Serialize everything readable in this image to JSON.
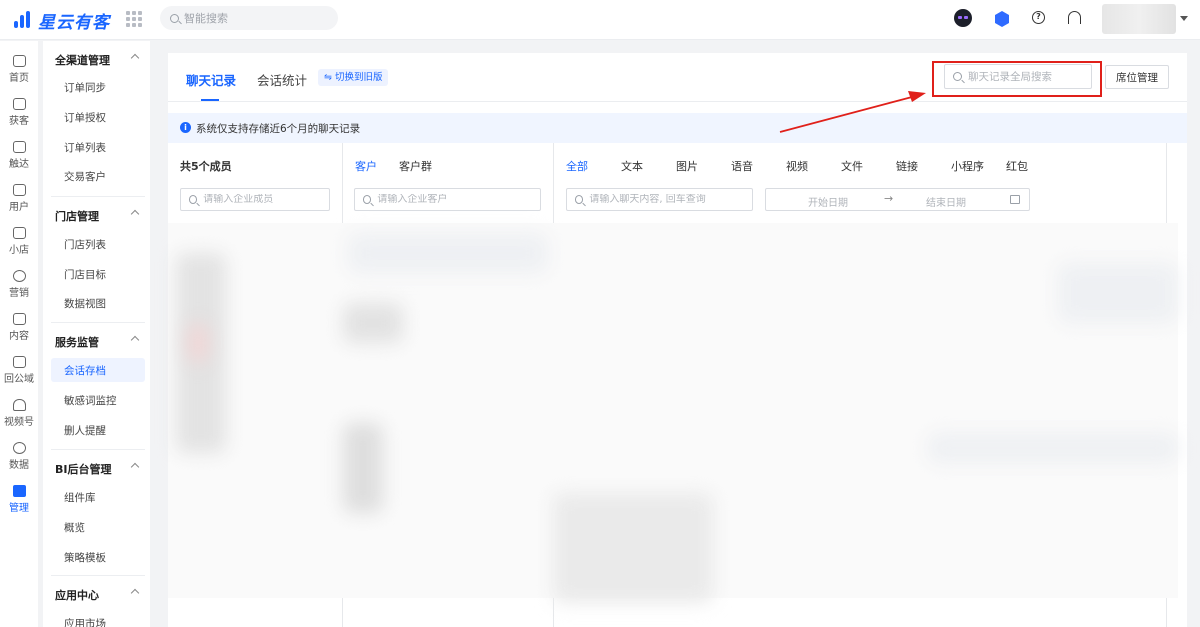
{
  "header": {
    "logo_text": "星云有客",
    "search_placeholder": "智能搜索",
    "icons": [
      "robot-assistant-icon",
      "cube-icon",
      "help-icon",
      "headset-icon"
    ]
  },
  "rail": {
    "items": [
      {
        "label": "首页",
        "icon": "home-icon"
      },
      {
        "label": "获客",
        "icon": "acquire-icon"
      },
      {
        "label": "触达",
        "icon": "send-icon"
      },
      {
        "label": "用户",
        "icon": "user-icon"
      },
      {
        "label": "小店",
        "icon": "store-icon"
      },
      {
        "label": "营销",
        "icon": "bulb-icon"
      },
      {
        "label": "内容",
        "icon": "folder-icon"
      },
      {
        "label": "回公域",
        "icon": "public-icon"
      },
      {
        "label": "视频号",
        "icon": "video-icon"
      },
      {
        "label": "数据",
        "icon": "pie-icon"
      },
      {
        "label": "管理",
        "icon": "manage-icon"
      }
    ],
    "active_index": 10
  },
  "submenu": {
    "groups": [
      {
        "title": "全渠道管理",
        "items": [
          "订单同步",
          "订单授权",
          "订单列表",
          "交易客户"
        ]
      },
      {
        "title": "门店管理",
        "items": [
          "门店列表",
          "门店目标",
          "数据视图"
        ]
      },
      {
        "title": "服务监管",
        "items": [
          "会话存档",
          "敏感词监控",
          "删人提醒"
        ]
      },
      {
        "title": "BI后台管理",
        "items": [
          "组件库",
          "概览",
          "策略模板"
        ]
      },
      {
        "title": "应用中心",
        "items": [
          "应用市场"
        ]
      }
    ],
    "active_item": "会话存档"
  },
  "main": {
    "tabs": [
      "聊天记录",
      "会话统计"
    ],
    "active_tab": "聊天记录",
    "switch_label": "⇋ 切换到旧版",
    "global_search_placeholder": "聊天记录全局搜索",
    "seat_button": "席位管理",
    "notice": "系统仅支持存储近6个月的聊天记录",
    "members_title": "共5个成员",
    "member_search_placeholder": "请输入企业成员",
    "customer_tabs": [
      "客户",
      "客户群"
    ],
    "customer_search_placeholder": "请输入企业客户",
    "message_types": [
      "全部",
      "文本",
      "图片",
      "语音",
      "视频",
      "文件",
      "链接",
      "小程序",
      "红包"
    ],
    "content_search_placeholder": "请输入聊天内容, 回车查询",
    "date_start_placeholder": "开始日期",
    "date_arrow": "→",
    "date_end_placeholder": "结束日期"
  },
  "colors": {
    "accent": "#1a66ff",
    "highlight": "#e0201a"
  }
}
